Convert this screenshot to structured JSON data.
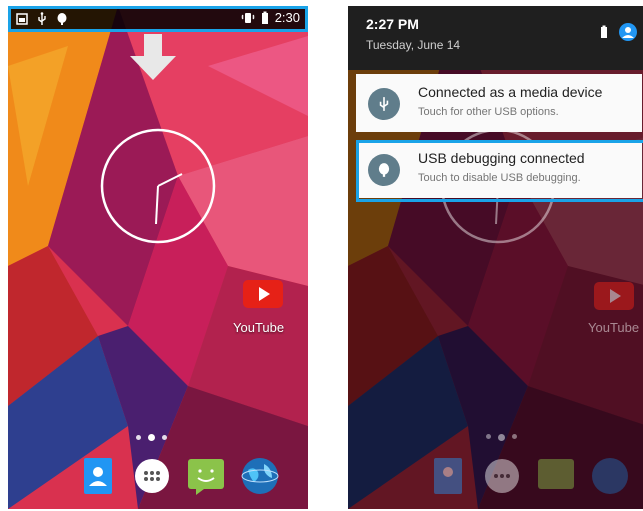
{
  "left_screen": {
    "status_bar": {
      "left_icons": [
        "screenshot-icon",
        "usb-icon",
        "android-debug-icon"
      ],
      "right_icons": [
        "vibrate-icon",
        "battery-icon"
      ],
      "time": "2:30"
    },
    "clock_widget": "analog-clock-icon",
    "app_youtube": {
      "label": "YouTube",
      "icon": "youtube-icon"
    },
    "page_indicator": {
      "count": 3,
      "active": 2
    },
    "dock": [
      "contacts-icon",
      "app-drawer-icon",
      "messaging-icon",
      "browser-icon"
    ]
  },
  "right_screen": {
    "header": {
      "time": "2:27 PM",
      "date": "Tuesday, June 14",
      "icons": [
        "battery-icon",
        "user-account-icon"
      ]
    },
    "notifications": [
      {
        "title": "Connected as a media device",
        "subtitle": "Touch for other USB options.",
        "icon": "usb-icon"
      },
      {
        "title": "USB debugging connected",
        "subtitle": "Touch to disable USB debugging.",
        "icon": "android-debug-icon"
      }
    ],
    "app_youtube": {
      "label": "YouTube"
    }
  },
  "colors": {
    "highlight": "#1aa3e8",
    "notification_icon_bg": "#607d8b"
  }
}
